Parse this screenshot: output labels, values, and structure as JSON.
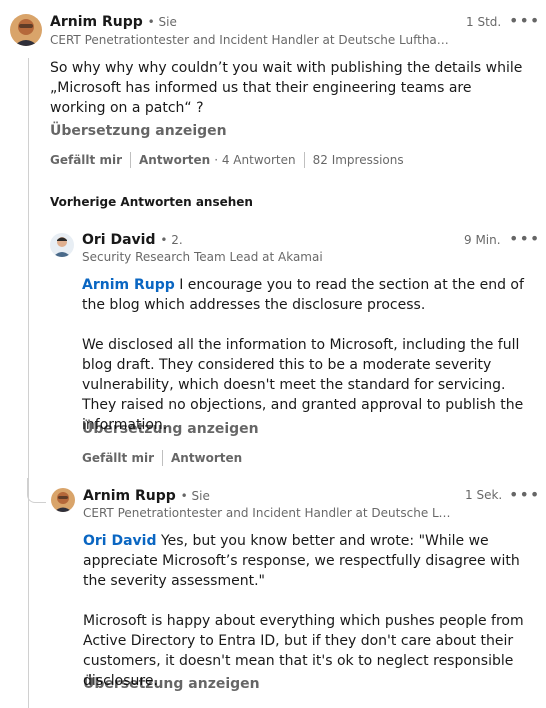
{
  "main_comment": {
    "author": "Arnim Rupp",
    "degree": "• Sie",
    "headline": "CERT Penetrationtester and Incident Handler at Deutsche Lufthansa A…",
    "time": "1 Std.",
    "text": "So why why why couldn’t you wait with publishing the details while „Microsoft has informed us that their engineering teams are working on a patch“ ?",
    "translate": "Übersetzung anzeigen",
    "like": "Gefällt mir",
    "reply": "Antworten",
    "reply_count": "· 4 Antworten",
    "impressions": "82 Impressions"
  },
  "previous_replies": "Vorherige Antworten ansehen",
  "reply_1": {
    "author": "Ori David",
    "degree": "• 2.",
    "headline": "Security Research Team Lead at Akamai",
    "time": "9 Min.",
    "mention": "Arnim Rupp",
    "text_p1": " I encourage you to read the section at the end of the blog which addresses the disclosure process.",
    "text_p2": "We disclosed all the information to Microsoft, including the full blog draft. They considered this to be a moderate severity vulnerability, which doesn't meet the standard for servicing. They raised no objections, and granted approval to publish the information.",
    "translate": "Übersetzung anzeigen",
    "like": "Gefällt mir",
    "reply": "Antworten"
  },
  "reply_2": {
    "author": "Arnim Rupp",
    "degree": "• Sie",
    "headline": "CERT Penetrationtester and Incident Handler at Deutsche Luftha…",
    "time": "1 Sek.",
    "mention": "Ori David",
    "text_p1": " Yes, but you know better and wrote: \"While we appreciate Microsoft’s response, we respectfully disagree with the severity assessment.\"",
    "text_p2": "Microsoft is happy about everything which pushes people from Active Directory to Entra ID, but if they don't care about their customers, it doesn't mean that it's ok to neglect responsible disclosure.",
    "translate": "Übersetzung anzeigen"
  },
  "icons": {
    "more": "more-options-icon"
  },
  "colors": {
    "link": "#0a66c2",
    "secondary_text": "rgba(0,0,0,0.6)",
    "thread_line": "#d0d0d0"
  }
}
